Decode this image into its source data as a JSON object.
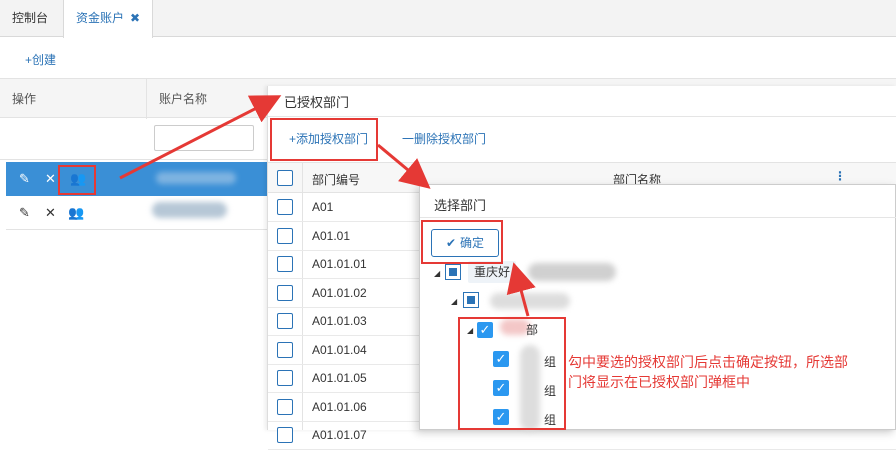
{
  "tabs": [
    {
      "label": "控制台",
      "active": false
    },
    {
      "label": "资金账户",
      "active": true
    }
  ],
  "toolbar": {
    "create_label": "+创建"
  },
  "grid": {
    "columns": [
      "操作",
      "账户名称"
    ]
  },
  "panel1": {
    "title": "已授权部门",
    "add_label": "+添加授权部门",
    "delete_label": "一删除授权部门",
    "col_code": "部门编号",
    "col_name": "部门名称",
    "codes": [
      "A01",
      "A01.01",
      "A01.01.01",
      "A01.01.02",
      "A01.01.03",
      "A01.01.04",
      "A01.01.05",
      "A01.01.06",
      "A01.01.07"
    ]
  },
  "panel2": {
    "title": "选择部门",
    "confirm_label": "确定",
    "tree_root": "重庆好",
    "tree_child": "部",
    "leaf_suffix": [
      "组",
      "组",
      "组"
    ]
  },
  "annotation": {
    "line1": "勾中要选的授权部门后点击确定按钮，所选部",
    "line2": "门将显示在已授权部门弹框中"
  },
  "colors": {
    "accent": "#2b73b6",
    "selected_row": "#3a8fd6",
    "annotation": "#e53935"
  }
}
